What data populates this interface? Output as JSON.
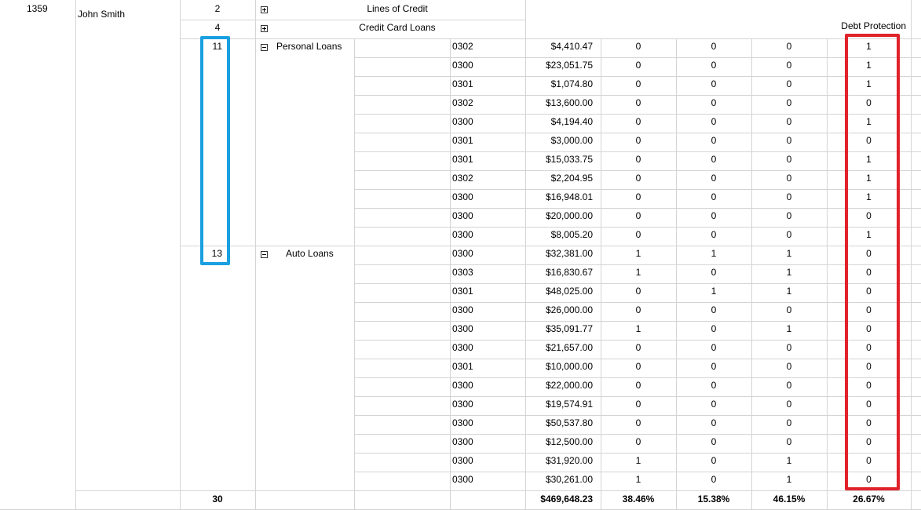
{
  "customer": {
    "id": "1359",
    "name": "John Smith"
  },
  "groups": [
    {
      "count": "2",
      "label": "Lines of Credit",
      "expanded": false
    },
    {
      "count": "4",
      "label": "Credit Card Loans",
      "expanded": false
    },
    {
      "count": "11",
      "label": "Personal Loans",
      "expanded": true
    },
    {
      "count": "13",
      "label": "Auto Loans",
      "expanded": true
    }
  ],
  "column_header": "Debt Protection",
  "rows": [
    [
      "0302",
      "$4,410.47",
      "0",
      "0",
      "0",
      "1"
    ],
    [
      "0300",
      "$23,051.75",
      "0",
      "0",
      "0",
      "1"
    ],
    [
      "0301",
      "$1,074.80",
      "0",
      "0",
      "0",
      "1"
    ],
    [
      "0302",
      "$13,600.00",
      "0",
      "0",
      "0",
      "0"
    ],
    [
      "0300",
      "$4,194.40",
      "0",
      "0",
      "0",
      "1"
    ],
    [
      "0301",
      "$3,000.00",
      "0",
      "0",
      "0",
      "0"
    ],
    [
      "0301",
      "$15,033.75",
      "0",
      "0",
      "0",
      "1"
    ],
    [
      "0302",
      "$2,204.95",
      "0",
      "0",
      "0",
      "1"
    ],
    [
      "0300",
      "$16,948.01",
      "0",
      "0",
      "0",
      "1"
    ],
    [
      "0300",
      "$20,000.00",
      "0",
      "0",
      "0",
      "0"
    ],
    [
      "0300",
      "$8,005.20",
      "0",
      "0",
      "0",
      "1"
    ],
    [
      "0300",
      "$32,381.00",
      "1",
      "1",
      "1",
      "0"
    ],
    [
      "0303",
      "$16,830.67",
      "1",
      "0",
      "1",
      "0"
    ],
    [
      "0301",
      "$48,025.00",
      "0",
      "1",
      "1",
      "0"
    ],
    [
      "0300",
      "$26,000.00",
      "0",
      "0",
      "0",
      "0"
    ],
    [
      "0300",
      "$35,091.77",
      "1",
      "0",
      "1",
      "0"
    ],
    [
      "0300",
      "$21,657.00",
      "0",
      "0",
      "0",
      "0"
    ],
    [
      "0301",
      "$10,000.00",
      "0",
      "0",
      "0",
      "0"
    ],
    [
      "0300",
      "$22,000.00",
      "0",
      "0",
      "0",
      "0"
    ],
    [
      "0300",
      "$19,574.91",
      "0",
      "0",
      "0",
      "0"
    ],
    [
      "0300",
      "$50,537.80",
      "0",
      "0",
      "0",
      "0"
    ],
    [
      "0300",
      "$12,500.00",
      "0",
      "0",
      "0",
      "0"
    ],
    [
      "0300",
      "$31,920.00",
      "1",
      "0",
      "1",
      "0"
    ],
    [
      "0300",
      "$30,261.00",
      "1",
      "0",
      "1",
      "0"
    ]
  ],
  "totals": {
    "count": "30",
    "amount": "$469,648.23",
    "pct1": "38.46%",
    "pct2": "15.38%",
    "pct3": "46.15%",
    "pct4": "26.67%"
  },
  "annotation_colors": {
    "blue": "#1aa0e0",
    "red": "#e0222a"
  }
}
